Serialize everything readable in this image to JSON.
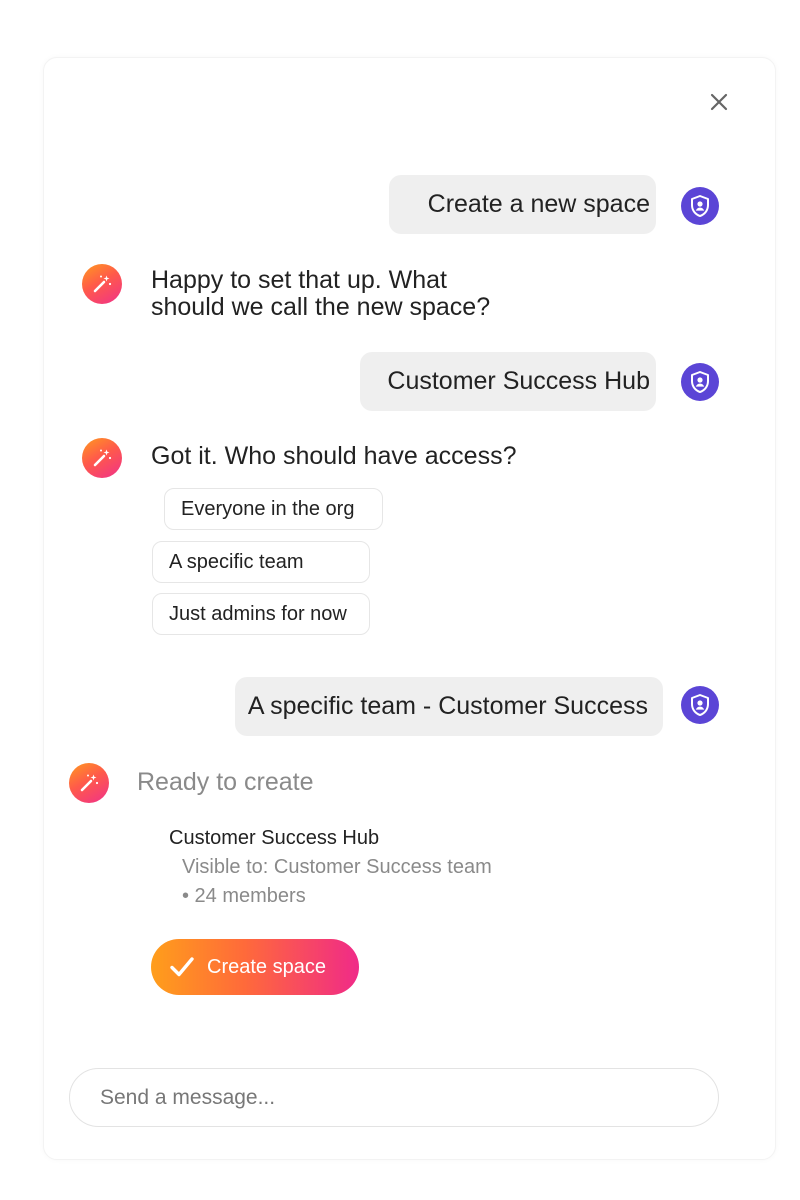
{
  "conversation": {
    "user_message_1": "Create a new space",
    "bot_message_1": "Happy to set that up. What should we call the new space?",
    "user_message_2": "Customer Success Hub",
    "bot_message_2": "Got it. Who should have access?",
    "access_options": [
      "Everyone in the org",
      "A specific team",
      "Just admins for now"
    ],
    "user_message_3": "A specific team - Customer Success"
  },
  "summary": {
    "heading": "Ready to create",
    "space_name": "Customer Success Hub",
    "visibility": "Visible to: Customer Success team",
    "members": "• 24 members",
    "create_label": "Create space"
  },
  "composer": {
    "placeholder": "Send a message..."
  },
  "icons": {
    "close": "close-icon",
    "user_avatar": "shield-user-icon",
    "assistant": "magic-wand-icon",
    "confirm": "checkmark-icon"
  },
  "colors": {
    "avatar_purple": "#5b45d6",
    "bubble_gray": "#efefef",
    "gradient_start": "#ff9e1b",
    "gradient_end": "#f02a88"
  }
}
